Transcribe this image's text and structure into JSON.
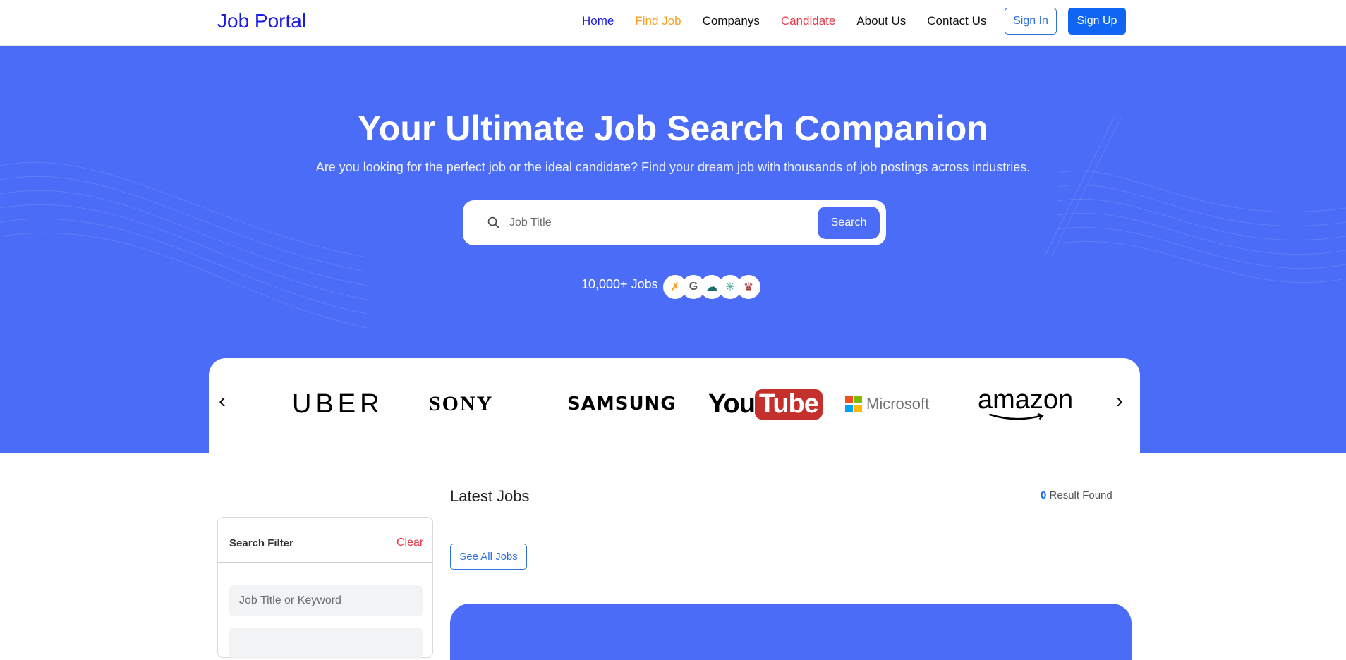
{
  "nav": {
    "brand": "Job Portal",
    "links": [
      "Home",
      "Find Job",
      "Companys",
      "Candidate",
      "About Us",
      "Contact Us"
    ],
    "sign_in": "Sign In",
    "sign_up": "Sign Up"
  },
  "hero": {
    "title": "Your Ultimate Job Search Companion",
    "subtitle": "Are you looking for the perfect job or the ideal candidate? Find your dream job with thousands of job postings across industries.",
    "search_placeholder": "Job Title",
    "search_button": "Search",
    "jobs_count": "10,000+ Jobs"
  },
  "brands": {
    "logos": [
      "UBER",
      "SONY",
      "SAMSUNG",
      "YouTube",
      "Microsoft",
      "amazon"
    ],
    "prev": "‹",
    "next": "›"
  },
  "filter": {
    "title": "Search Filter",
    "clear": "Clear",
    "keyword_placeholder": "Job Title or Keyword"
  },
  "jobs": {
    "title": "Latest Jobs",
    "result_count": "0",
    "result_label": "Result Found",
    "see_all": "See All Jobs"
  },
  "colors": {
    "primary": "#4a6cf7",
    "brand_blue": "#1a1ae6",
    "accent_orange": "#f59f1b",
    "accent_red": "#e53945",
    "button_blue": "#1066f2"
  }
}
